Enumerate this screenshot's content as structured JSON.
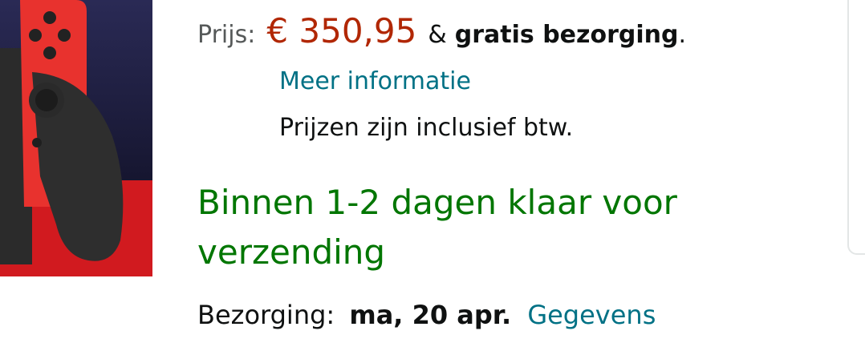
{
  "price": {
    "label": "Prijs:",
    "amount": "€ 350,95",
    "amp": "&",
    "free_shipping": "gratis bezorging",
    "period": "."
  },
  "more_info_link": "Meer informatie",
  "vat_note": "Prijzen zijn inclusief btw.",
  "availability": "Binnen 1-2 dagen klaar voor verzending",
  "delivery": {
    "label": "Bezorging:",
    "date": "ma, 20 apr.",
    "details_link": "Gegevens"
  },
  "colors": {
    "price": "#B12704",
    "link": "#007185",
    "availability": "#007600"
  },
  "product_image": {
    "icon": "game-console-product-image"
  }
}
